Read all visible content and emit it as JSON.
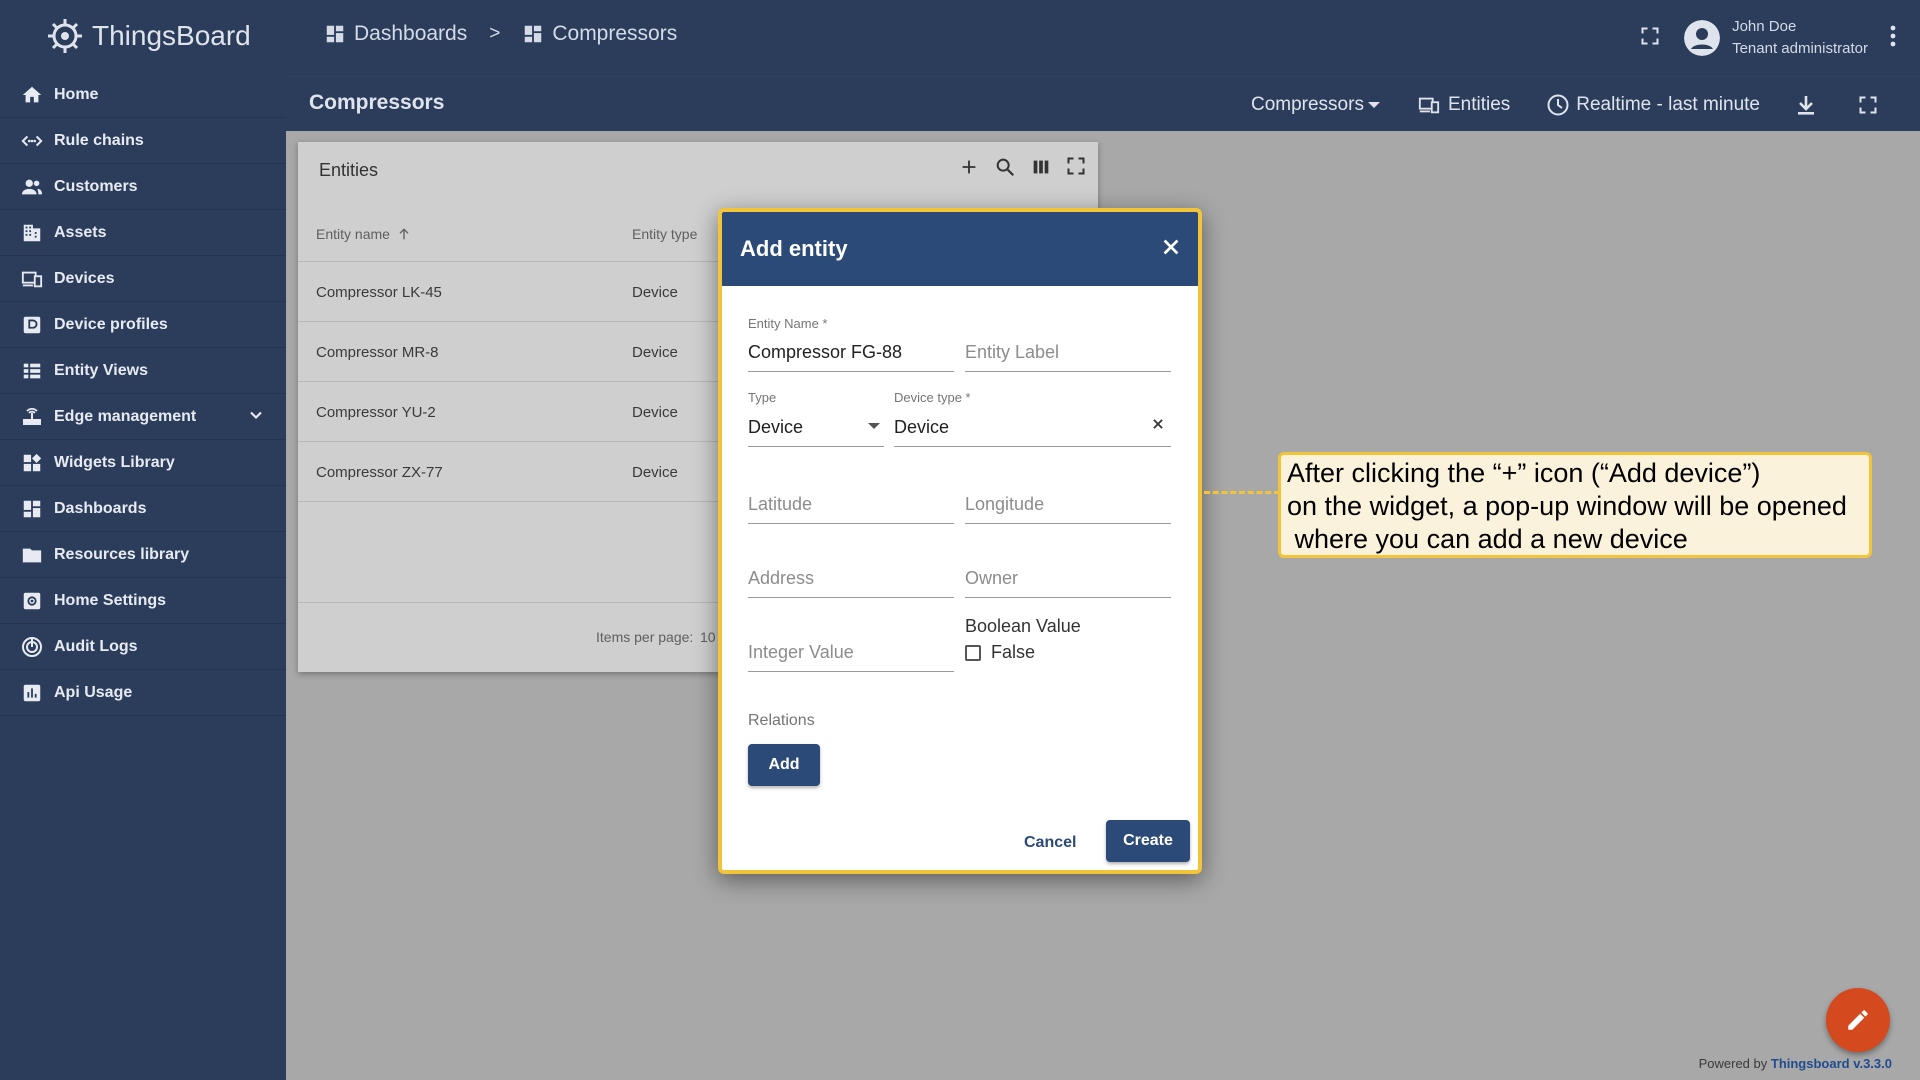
{
  "app": {
    "logo_text": "ThingsBoard"
  },
  "sidebar": {
    "items": [
      {
        "label": "Home",
        "icon": "home-icon"
      },
      {
        "label": "Rule chains",
        "icon": "rule-chains-icon"
      },
      {
        "label": "Customers",
        "icon": "customers-icon"
      },
      {
        "label": "Assets",
        "icon": "assets-icon"
      },
      {
        "label": "Devices",
        "icon": "devices-icon"
      },
      {
        "label": "Device profiles",
        "icon": "device-profiles-icon"
      },
      {
        "label": "Entity Views",
        "icon": "entity-views-icon"
      },
      {
        "label": "Edge management",
        "icon": "edge-icon",
        "expandable": true
      },
      {
        "label": "Widgets Library",
        "icon": "widgets-icon"
      },
      {
        "label": "Dashboards",
        "icon": "dashboards-icon"
      },
      {
        "label": "Resources library",
        "icon": "folder-icon"
      },
      {
        "label": "Home Settings",
        "icon": "settings-icon"
      },
      {
        "label": "Audit Logs",
        "icon": "audit-icon"
      },
      {
        "label": "Api Usage",
        "icon": "api-usage-icon"
      }
    ]
  },
  "header": {
    "breadcrumbs": [
      "Dashboards",
      ">",
      "Compressors"
    ],
    "user": {
      "name": "John Doe",
      "role": "Tenant administrator"
    }
  },
  "dashboard": {
    "title": "Compressors",
    "state_label": "Compressors",
    "entities_label": "Entities",
    "timewindow_label": "Realtime - last minute"
  },
  "widget": {
    "title": "Entities",
    "columns": [
      "Entity name",
      "Entity type"
    ],
    "rows": [
      {
        "name": "Compressor LK-45",
        "type": "Device"
      },
      {
        "name": "Compressor MR-8",
        "type": "Device"
      },
      {
        "name": "Compressor YU-2",
        "type": "Device"
      },
      {
        "name": "Compressor ZX-77",
        "type": "Device"
      }
    ],
    "items_per_page_label": "Items per page:",
    "items_per_page_value": "10"
  },
  "dialog": {
    "title": "Add entity",
    "entity_name_label": "Entity Name *",
    "entity_name_value": "Compressor FG-88",
    "entity_label_placeholder": "Entity Label",
    "type_label": "Type",
    "type_value": "Device",
    "device_type_label": "Device type *",
    "device_type_value": "Device",
    "latitude_placeholder": "Latitude",
    "longitude_placeholder": "Longitude",
    "address_placeholder": "Address",
    "owner_placeholder": "Owner",
    "integer_placeholder": "Integer Value",
    "boolean_label": "Boolean Value",
    "boolean_value_label": "False",
    "relations_label": "Relations",
    "add_button": "Add",
    "cancel_button": "Cancel",
    "create_button": "Create"
  },
  "callout": {
    "text": "After clicking the “+” icon (“Add device”)\non the widget, a pop-up window will be opened\n where you can add a new device"
  },
  "footer": {
    "powered_by": "Powered by",
    "powered_link": "Thingsboard v.3.3.0"
  },
  "colors": {
    "primary": "#2c3d5c",
    "dialog_header": "#2c4a77",
    "highlight": "#f2c43a",
    "fab": "#d44a1e"
  }
}
